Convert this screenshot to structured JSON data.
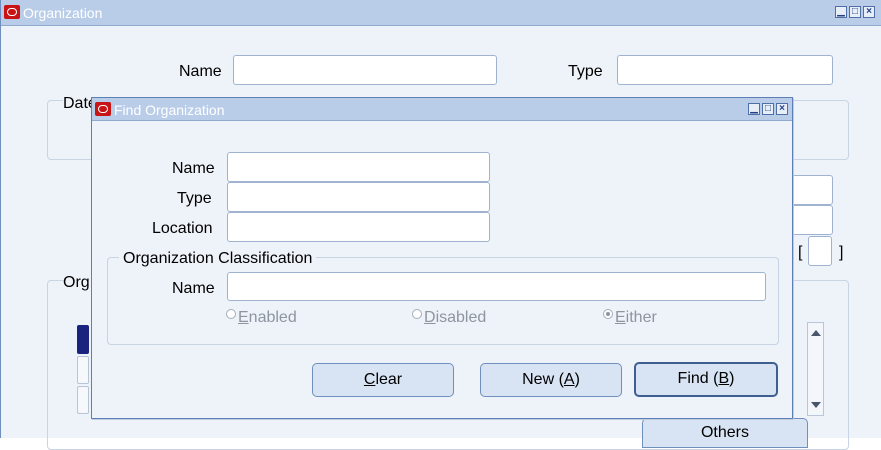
{
  "main": {
    "title": "Organization",
    "name_label": "Name",
    "type_label": "Type",
    "dates_label": "Date",
    "org_label": "Org",
    "bracket_open": "[",
    "bracket_close": "]",
    "others_button": "Others"
  },
  "dialog": {
    "title": "Find Organization",
    "name_label": "Name",
    "type_label": "Type",
    "location_label": "Location",
    "name_value": "",
    "type_value": "",
    "location_value": "",
    "classification": {
      "title": "Organization Classification",
      "name_label": "Name",
      "name_value": "",
      "options": [
        {
          "mnemonic": "E",
          "rest": "nabled",
          "selected": false
        },
        {
          "mnemonic": "D",
          "rest": "isabled",
          "selected": false
        },
        {
          "mnemonic": "E",
          "rest": "ither",
          "selected": true
        }
      ]
    },
    "buttons": {
      "clear": {
        "pre": "",
        "mnemonic": "C",
        "post": "lear"
      },
      "new": {
        "pre": "New (",
        "mnemonic": "A",
        "post": ")"
      },
      "find": {
        "pre": "Find (",
        "mnemonic": "B",
        "post": ")"
      }
    }
  },
  "window_controls": {
    "minimize": "▁",
    "maximize": "□",
    "close": "×"
  },
  "colors": {
    "accent": "#b9cde8",
    "brand_icon": "#c81414",
    "selected_row": "#1a237e"
  }
}
